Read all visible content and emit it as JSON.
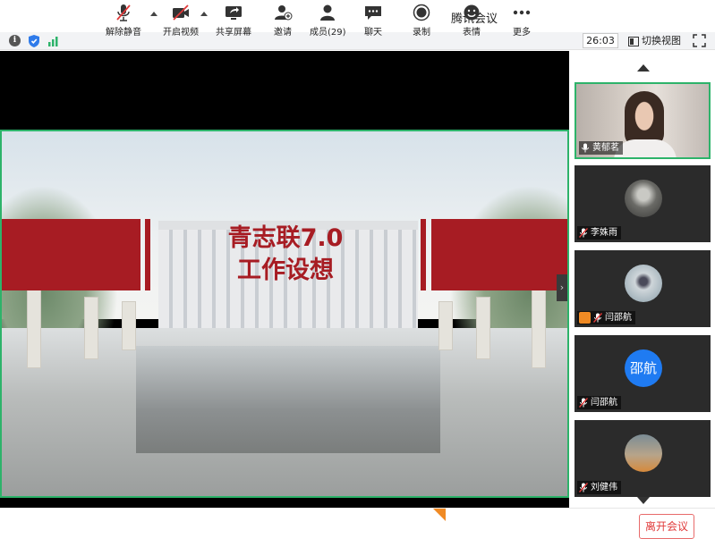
{
  "window": {
    "title": "腾讯会议"
  },
  "infobar": {
    "timer": "26:03",
    "switch_view": "切换视图"
  },
  "slide": {
    "line1": "青志联7.0",
    "line2": "工作设想"
  },
  "participants": [
    {
      "name": "黄郁茗",
      "type": "video",
      "muted": false,
      "active": true
    },
    {
      "name": "李姝雨",
      "type": "photo",
      "muted": true,
      "active": false
    },
    {
      "name": "闫邵航",
      "type": "photo",
      "muted": true,
      "active": false,
      "host_badge": true
    },
    {
      "name": "闫邵航",
      "type": "initials",
      "initials": "邵航",
      "muted": true,
      "active": false
    },
    {
      "name": "刘健伟",
      "type": "photo",
      "muted": true,
      "active": false
    }
  ],
  "toolbar": {
    "unmute": "解除静音",
    "start_video": "开启视频",
    "share_screen": "共享屏幕",
    "invite": "邀请",
    "members": "成员(29)",
    "chat": "聊天",
    "record": "录制",
    "reactions": "表情",
    "more": "更多",
    "leave": "离开会议"
  },
  "colors": {
    "accent_green": "#2db36a",
    "banner_red": "#a71c23",
    "leave_red": "#e03a3a",
    "avatar_blue": "#1f7bf2"
  }
}
